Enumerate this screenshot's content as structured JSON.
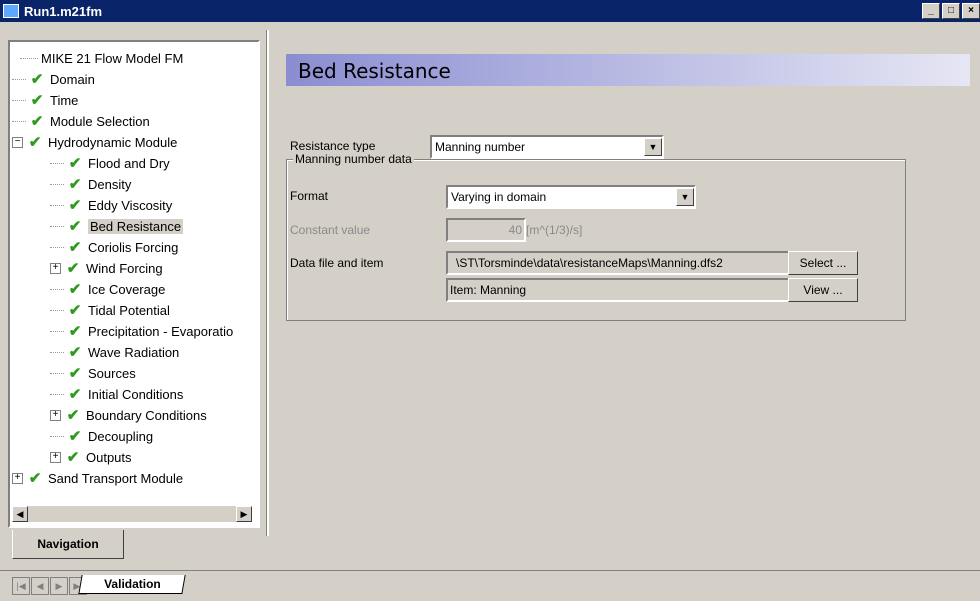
{
  "window": {
    "title": "Run1.m21fm",
    "controls": [
      "_",
      "□",
      "×"
    ]
  },
  "navigation": {
    "tab_label": "Navigation",
    "tree": [
      {
        "label": "MIKE 21 Flow Model FM",
        "level": 0,
        "check": false,
        "expander": ""
      },
      {
        "label": "Domain",
        "level": 1,
        "check": true,
        "expander": ""
      },
      {
        "label": "Time",
        "level": 1,
        "check": true,
        "expander": ""
      },
      {
        "label": "Module Selection",
        "level": 1,
        "check": true,
        "expander": ""
      },
      {
        "label": "Hydrodynamic Module",
        "level": 1,
        "check": true,
        "expander": "−"
      },
      {
        "label": "Flood and Dry",
        "level": 2,
        "check": true,
        "expander": ""
      },
      {
        "label": "Density",
        "level": 2,
        "check": true,
        "expander": ""
      },
      {
        "label": "Eddy Viscosity",
        "level": 2,
        "check": true,
        "expander": ""
      },
      {
        "label": "Bed Resistance",
        "level": 2,
        "check": true,
        "expander": "",
        "selected": true
      },
      {
        "label": "Coriolis Forcing",
        "level": 2,
        "check": true,
        "expander": ""
      },
      {
        "label": "Wind Forcing",
        "level": 2,
        "check": true,
        "expander": "+"
      },
      {
        "label": "Ice Coverage",
        "level": 2,
        "check": true,
        "expander": ""
      },
      {
        "label": "Tidal Potential",
        "level": 2,
        "check": true,
        "expander": ""
      },
      {
        "label": "Precipitation - Evaporatio",
        "level": 2,
        "check": true,
        "expander": ""
      },
      {
        "label": "Wave Radiation",
        "level": 2,
        "check": true,
        "expander": ""
      },
      {
        "label": "Sources",
        "level": 2,
        "check": true,
        "expander": ""
      },
      {
        "label": "Initial Conditions",
        "level": 2,
        "check": true,
        "expander": ""
      },
      {
        "label": "Boundary Conditions",
        "level": 2,
        "check": true,
        "expander": "+"
      },
      {
        "label": "Decoupling",
        "level": 2,
        "check": true,
        "expander": ""
      },
      {
        "label": "Outputs",
        "level": 2,
        "check": true,
        "expander": "+"
      },
      {
        "label": "Sand Transport Module",
        "level": 1,
        "check": true,
        "expander": "+"
      }
    ]
  },
  "panel": {
    "title": "Bed Resistance",
    "resistance_type_label": "Resistance type",
    "resistance_type_value": "Manning number",
    "group_title": "Manning number data",
    "format_label": "Format",
    "format_value": "Varying in domain",
    "constant_label": "Constant value",
    "constant_value": "40",
    "constant_unit": "[m^(1/3)/s]",
    "datafile_label": "Data file and item",
    "datafile_value": "\\ST\\Torsminde\\data\\resistanceMaps\\Manning.dfs2",
    "item_value": "Item:  Manning",
    "select_button": "Select ...",
    "view_button": "View ..."
  },
  "bottom": {
    "tab_label": "Validation"
  },
  "colors": {
    "title_bar": "#0a246a",
    "check": "#2e9a1f",
    "header_gradient_start": "#8a8ed1",
    "face": "#d4d0c8"
  }
}
